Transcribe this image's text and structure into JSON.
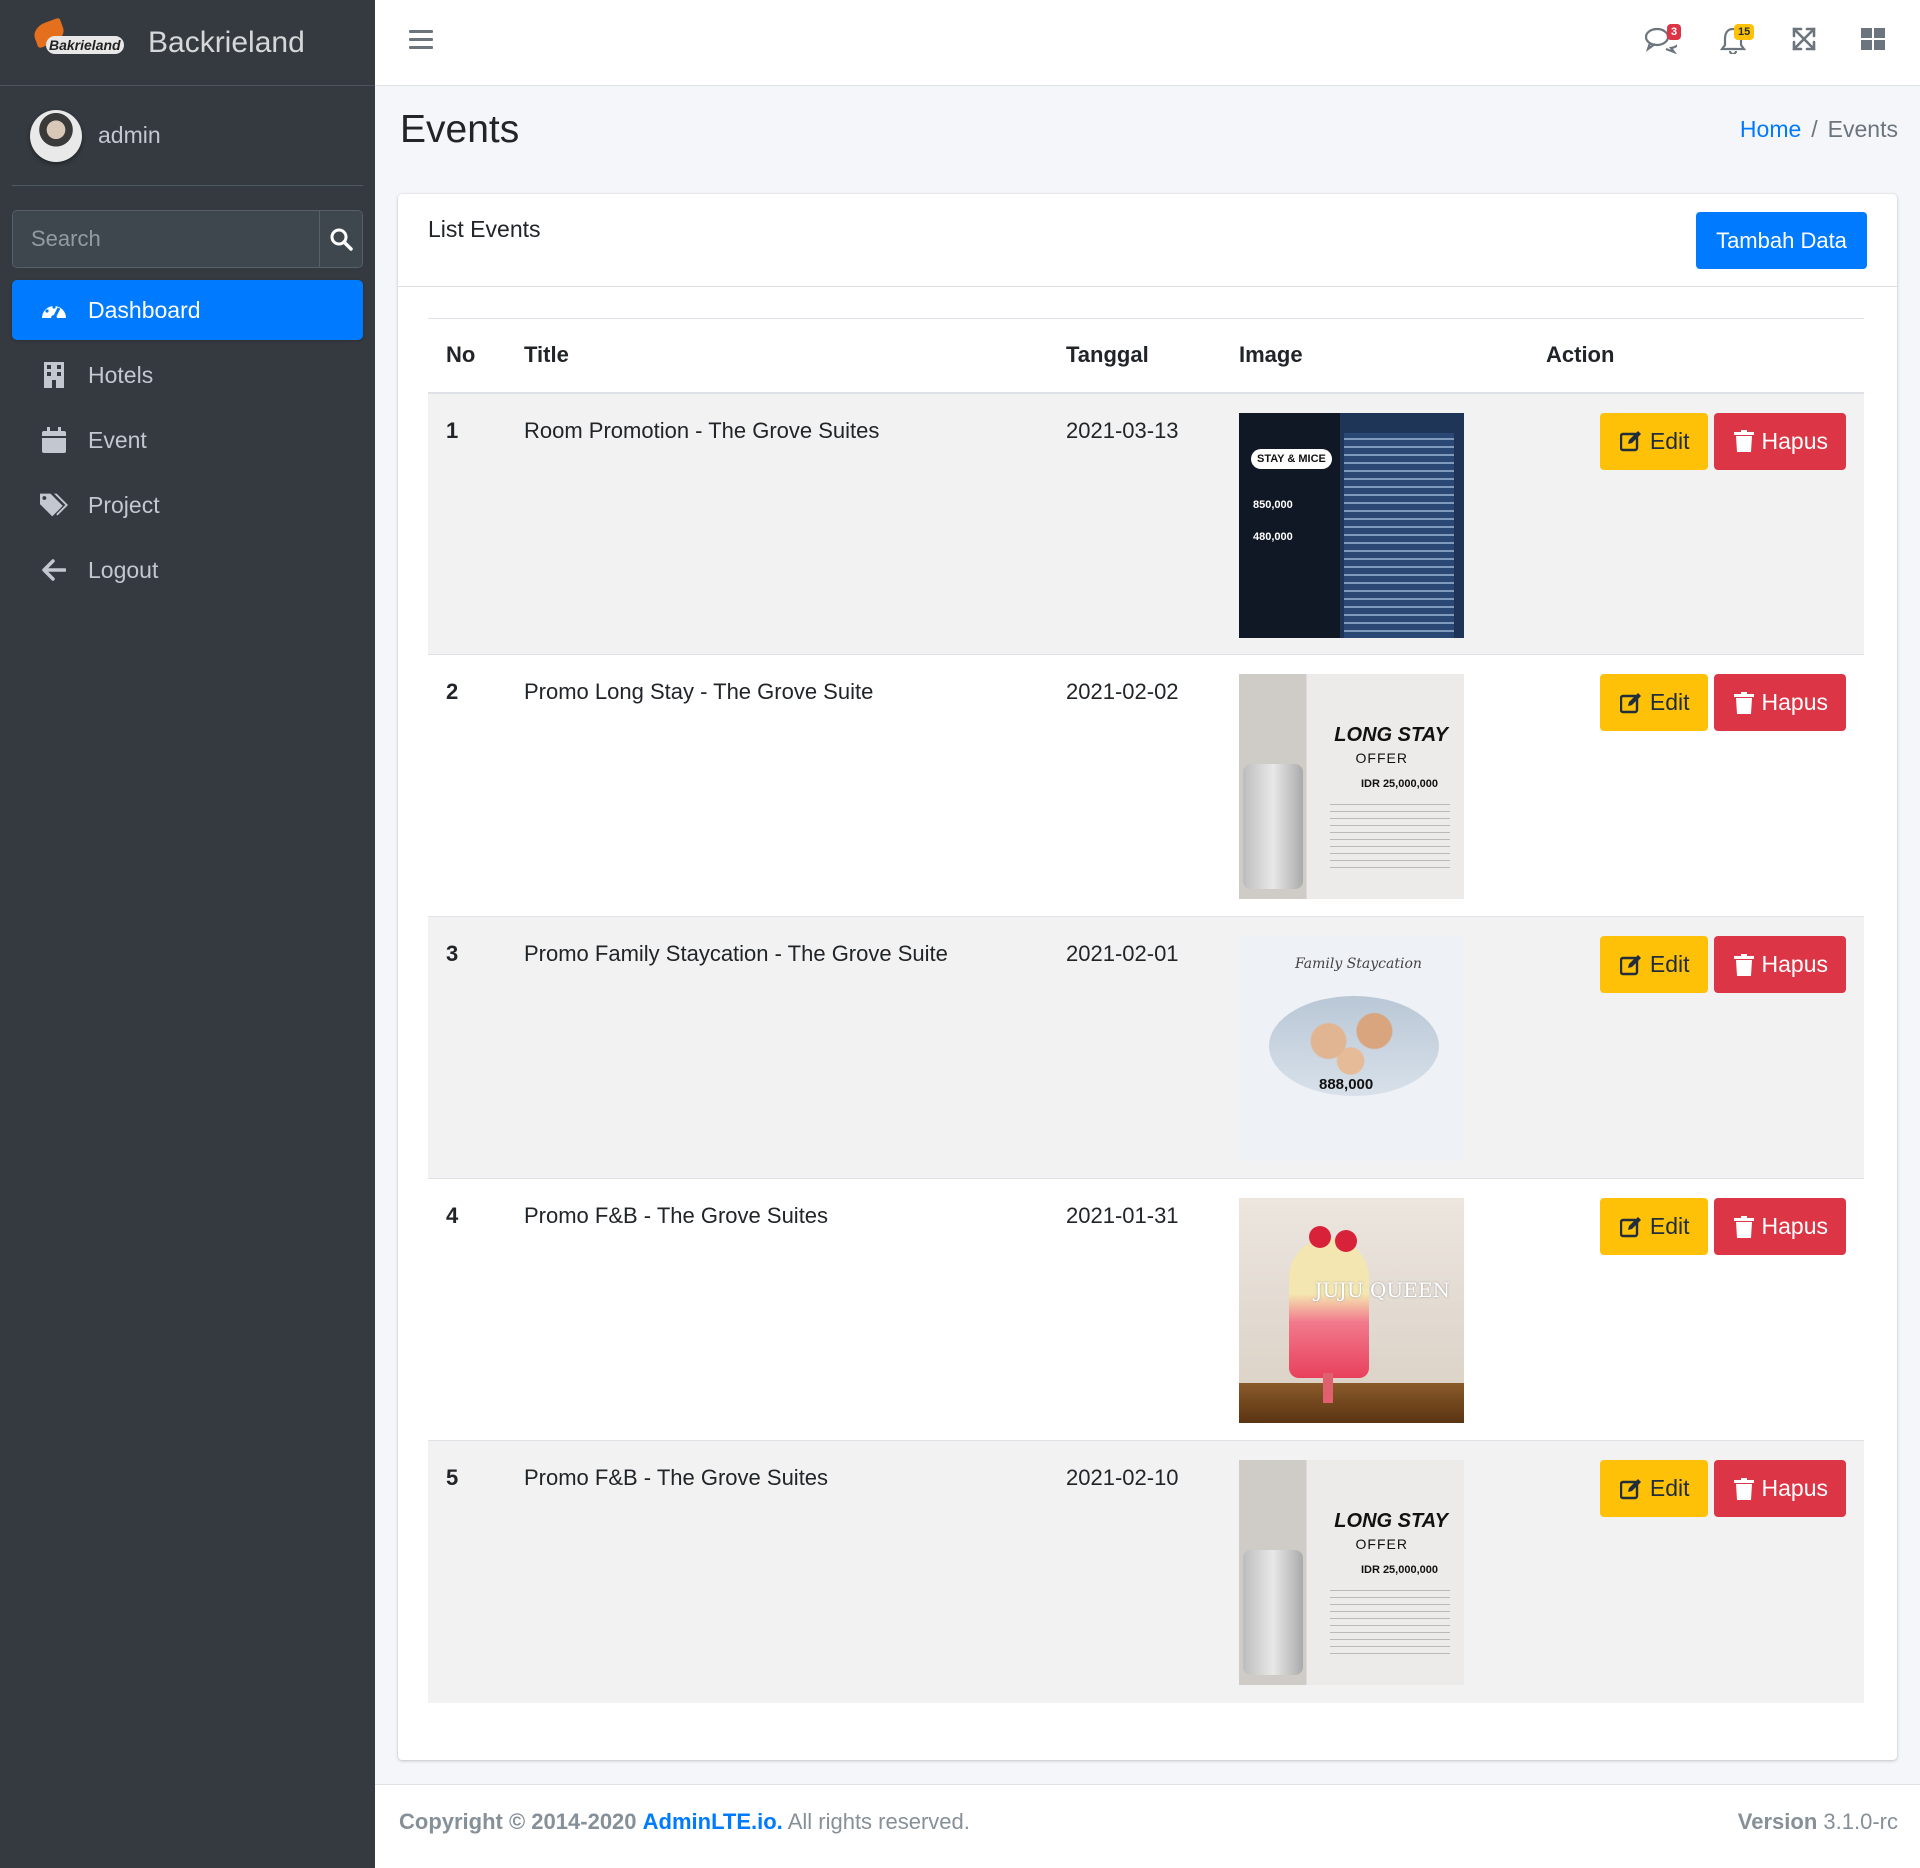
{
  "brand": {
    "logo_text": "Bakrieland",
    "name": "Backrieland"
  },
  "user": {
    "name": "admin"
  },
  "search": {
    "placeholder": "Search"
  },
  "sidebar": {
    "items": [
      {
        "label": "Dashboard",
        "icon": "tachometer-icon",
        "active": true
      },
      {
        "label": "Hotels",
        "icon": "building-icon"
      },
      {
        "label": "Event",
        "icon": "calendar-icon"
      },
      {
        "label": "Project",
        "icon": "tags-icon"
      },
      {
        "label": "Logout",
        "icon": "arrow-left-icon"
      }
    ]
  },
  "header": {
    "messages_badge": "3",
    "notifications_badge": "15"
  },
  "page": {
    "title": "Events",
    "breadcrumb": {
      "home": "Home",
      "separator": "/",
      "current": "Events"
    }
  },
  "card": {
    "title": "List Events",
    "add_button": "Tambah Data",
    "columns": {
      "no": "No",
      "title": "Title",
      "date": "Tanggal",
      "image": "Image",
      "action": "Action"
    },
    "rows": [
      {
        "no": "1",
        "title": "Room Promotion - The Grove Suites",
        "date": "2021-03-13",
        "image": "stay-mice-offer-poster"
      },
      {
        "no": "2",
        "title": "Promo Long Stay - The Grove Suite",
        "date": "2021-02-02",
        "image": "long-stay-offer-poster"
      },
      {
        "no": "3",
        "title": "Promo Family Staycation - The Grove Suite",
        "date": "2021-02-01",
        "image": "family-staycation-poster"
      },
      {
        "no": "4",
        "title": "Promo F&B - The Grove Suites",
        "date": "2021-01-31",
        "image": "juju-queen-drink-poster"
      },
      {
        "no": "5",
        "title": "Promo F&B - The Grove Suites",
        "date": "2021-02-10",
        "image": "long-stay-offer-poster"
      }
    ],
    "edit_label": "Edit",
    "delete_label": "Hapus"
  },
  "thumbs": {
    "t1_tag": "STAY & MICE",
    "t1_price1": "850,000",
    "t1_price2": "480,000",
    "t2_h1": "LONG STAY",
    "t2_h2": "OFFER",
    "t2_h3": "IDR 25,000,000",
    "t3_script": "Family Staycation",
    "t3_price": "888,000",
    "t4_text": "JUJU QUEEN"
  },
  "footer": {
    "copyright_prefix": "Copyright © 2014-2020",
    "copyright_link": "AdminLTE.io.",
    "copyright_suffix": "All rights reserved.",
    "version_label": "Version",
    "version_value": "3.1.0-rc"
  },
  "colors": {
    "primary": "#007bff",
    "warning": "#ffc107",
    "danger": "#dc3545",
    "sidebar": "#343a40"
  }
}
